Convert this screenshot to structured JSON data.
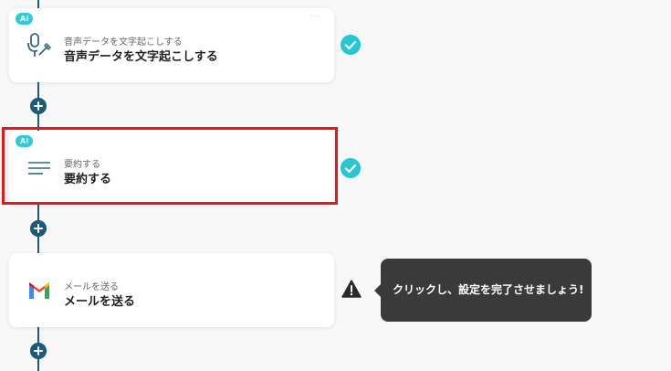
{
  "steps": [
    {
      "badge": "AI",
      "subtitle": "音声データを文字起こしする",
      "title": "音声データを文字起こしする",
      "icon": "microphone-pen-icon",
      "status": "complete"
    },
    {
      "badge": "AI",
      "subtitle": "要約する",
      "title": "要約する",
      "icon": "summary-lines-icon",
      "status": "complete"
    },
    {
      "subtitle": "メールを送る",
      "title": "メールを送る",
      "icon": "gmail-icon",
      "status": "warning"
    }
  ],
  "tooltip": {
    "text": "クリックし、設定を完了させましょう!"
  },
  "colors": {
    "accent": "#27c6d6",
    "flow_line": "#1d5a79",
    "highlight": "#e5191c",
    "tooltip_bg": "#3a3a3a"
  }
}
